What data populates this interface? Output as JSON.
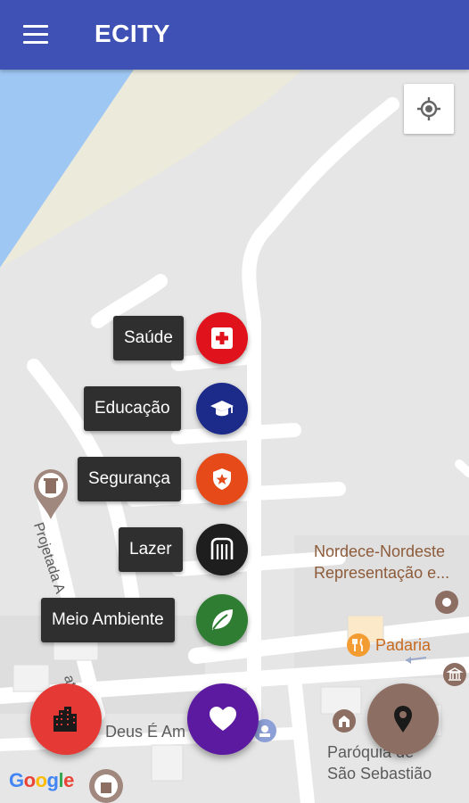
{
  "app_bar": {
    "title": "ECITY",
    "menu_icon": "hamburger-menu-icon"
  },
  "map": {
    "locate_icon": "my-location-icon",
    "labels": {
      "nordece_line1": "Nordece-Nordeste",
      "nordece_line2": "Representação e...",
      "padaria": "Padaria",
      "deus_e_am": "Deus É Am",
      "paroquia_line1": "Paróquia de",
      "paroquia_line2": "São Sebastião",
      "street_projetada": "Projetada A",
      "street_matadouro": "atadouro"
    },
    "attribution": {
      "g1": "G",
      "o1": "o",
      "o2": "o",
      "g2": "g",
      "l": "l",
      "e": "e"
    }
  },
  "fab_menu": {
    "items": [
      {
        "label": "Saúde",
        "icon": "health-cross-icon",
        "color": "#e0121b"
      },
      {
        "label": "Educação",
        "icon": "graduation-cap-icon",
        "color": "#1c2a8a"
      },
      {
        "label": "Segurança",
        "icon": "police-badge-icon",
        "color": "#e64a19"
      },
      {
        "label": "Lazer",
        "icon": "leisure-gate-icon",
        "color": "#1e1e1e"
      },
      {
        "label": "Meio Ambiente",
        "icon": "leaf-icon",
        "color": "#2e7d32"
      }
    ]
  },
  "fabs": {
    "left": {
      "icon": "city-buildings-icon",
      "color": "#e53935"
    },
    "center": {
      "icon": "heart-icon",
      "color": "#5b1aa0"
    },
    "right": {
      "icon": "location-pin-icon",
      "color": "#8d6e63"
    }
  }
}
